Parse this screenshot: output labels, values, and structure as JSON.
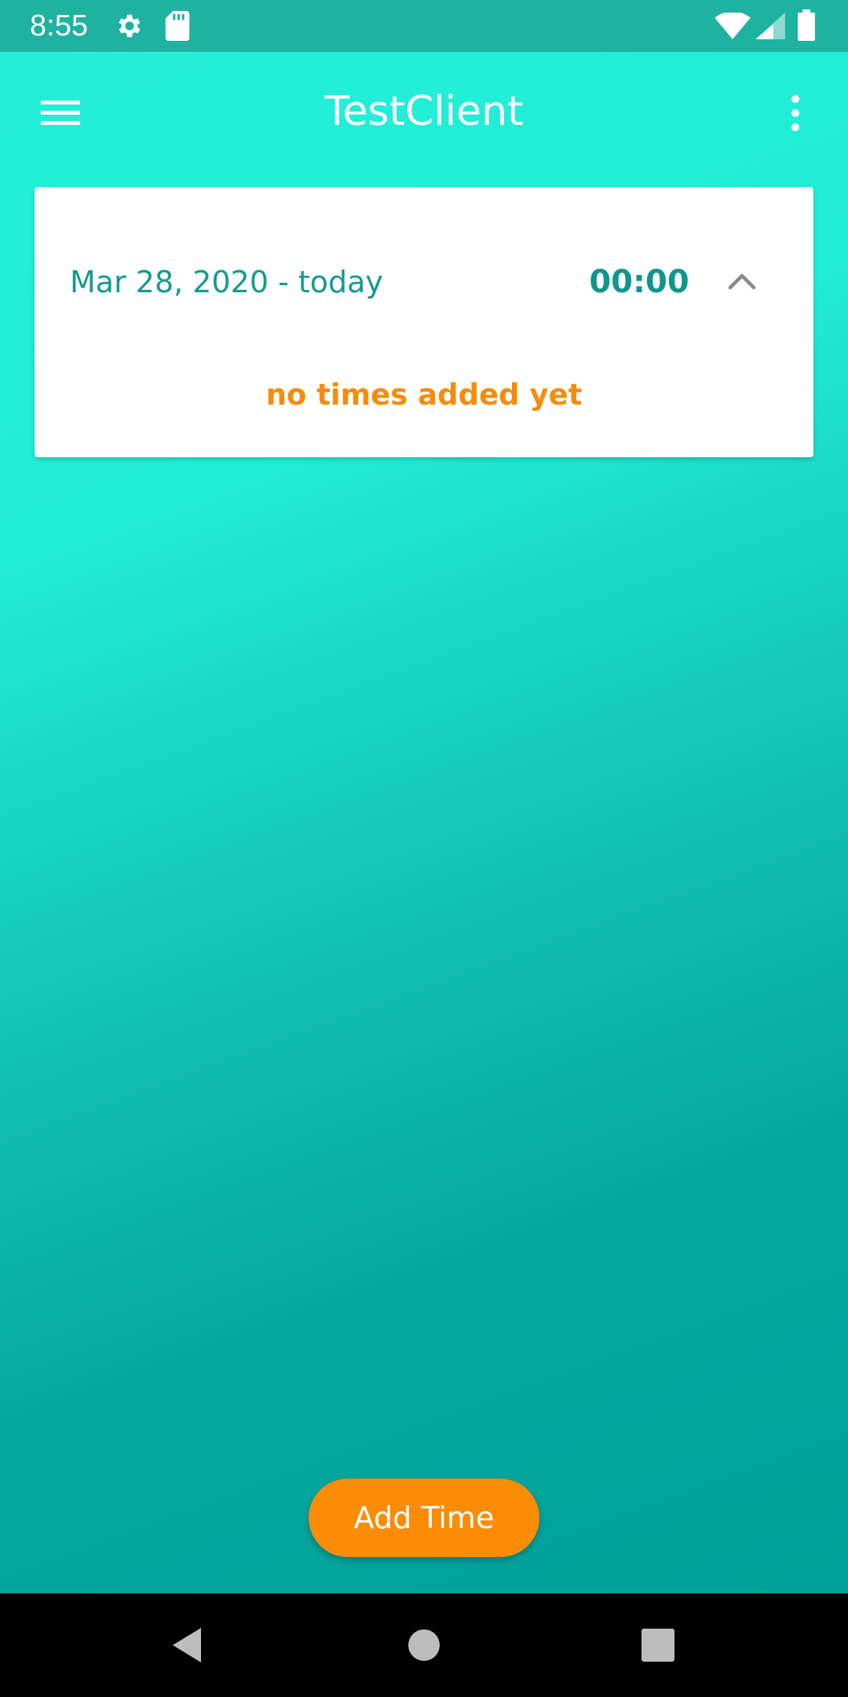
{
  "status_bar": {
    "time": "8:55",
    "icons": [
      "settings-icon",
      "sd-card-icon",
      "wifi-icon",
      "signal-icon",
      "battery-icon"
    ]
  },
  "toolbar": {
    "title": "TestClient",
    "menu_icon": "hamburger-menu-icon",
    "overflow_icon": "more-vertical-icon"
  },
  "time_card": {
    "period": "Mar 28, 2020 - today",
    "total": "00:00",
    "expand_icon": "chevron-up-icon",
    "empty_message": "no times added yet"
  },
  "fab": {
    "label": "Add Time"
  },
  "nav_bar": {
    "icons": [
      "back-icon",
      "home-icon",
      "recents-icon"
    ]
  },
  "colors": {
    "status_bar": "#1eb3a0",
    "gradient_top": "#24efd8",
    "gradient_bottom": "#01a09a",
    "accent_orange": "#fb8c06",
    "teal_text": "#149a92"
  }
}
